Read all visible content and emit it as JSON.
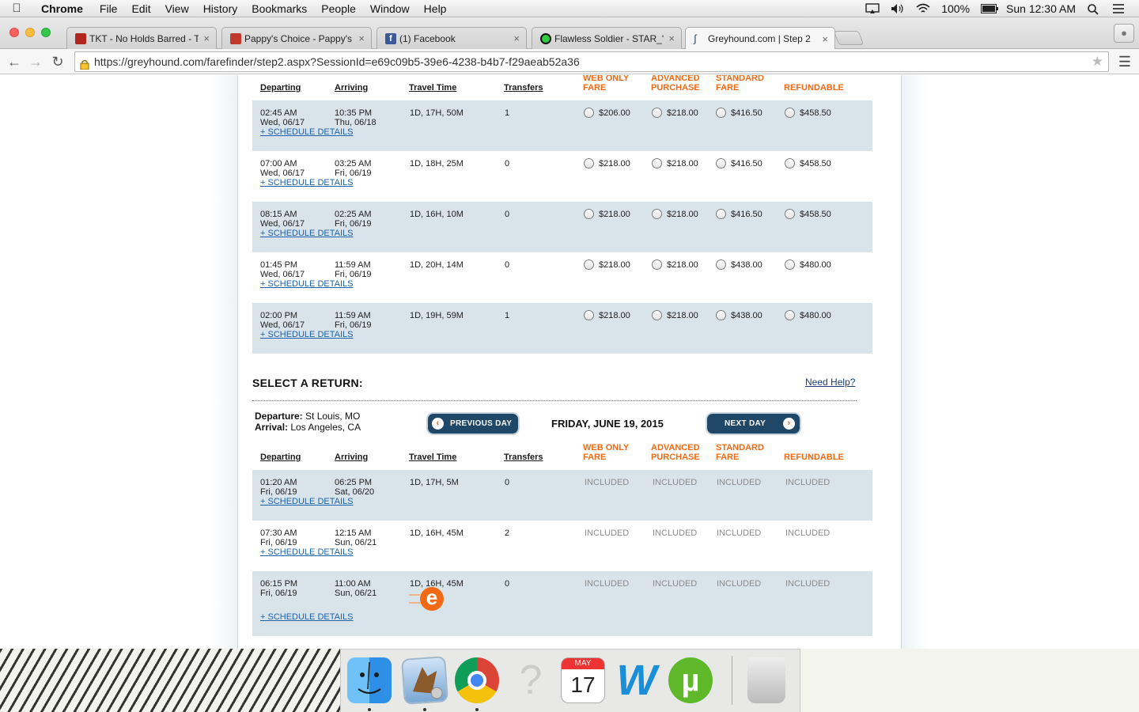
{
  "menubar": {
    "app": "Chrome",
    "items": [
      "File",
      "Edit",
      "View",
      "History",
      "Bookmarks",
      "People",
      "Window",
      "Help"
    ],
    "battery": "100%",
    "clock": "Sun 12:30 AM"
  },
  "tabs": [
    {
      "title": "TKT - No Holds Barred - T",
      "favicon_color": "#b3261e"
    },
    {
      "title": "Pappy's Choice - Pappy's",
      "favicon_color": "#c0392b"
    },
    {
      "title": "(1) Facebook",
      "favicon_color": "#3b5998"
    },
    {
      "title": "Flawless Soldier - STAR_'s",
      "favicon_color": "#2ecc40"
    },
    {
      "title": "Greyhound.com | Step 2",
      "favicon_color": "#1e4768"
    }
  ],
  "url": "https://greyhound.com/farefinder/step2.aspx?SessionId=e69c09b5-39e6-4238-b4b7-f29aeab52a36",
  "columns": {
    "departing": "Departing",
    "arriving": "Arriving",
    "travel_time": "Travel Time",
    "transfers": "Transfers",
    "web_only_1": "WEB ONLY",
    "web_only_2": "FARE",
    "advanced_1": "ADVANCED",
    "advanced_2": "PURCHASE",
    "standard_1": "STANDARD",
    "standard_2": "FARE",
    "refundable": "REFUNDABLE"
  },
  "schedule_details": "+ SCHEDULE DETAILS",
  "outbound": [
    {
      "dep_time": "02:45 AM",
      "dep_date": "Wed, 06/17",
      "arr_time": "10:35 PM",
      "arr_date": "Thu, 06/18",
      "travel": "1D, 17H, 50M",
      "transfers": "1",
      "web": "$206.00",
      "adv": "$218.00",
      "std": "$416.50",
      "ref": "$458.50"
    },
    {
      "dep_time": "07:00 AM",
      "dep_date": "Wed, 06/17",
      "arr_time": "03:25 AM",
      "arr_date": "Fri, 06/19",
      "travel": "1D, 18H, 25M",
      "transfers": "0",
      "web": "$218.00",
      "adv": "$218.00",
      "std": "$416.50",
      "ref": "$458.50"
    },
    {
      "dep_time": "08:15 AM",
      "dep_date": "Wed, 06/17",
      "arr_time": "02:25 AM",
      "arr_date": "Fri, 06/19",
      "travel": "1D, 16H, 10M",
      "transfers": "0",
      "web": "$218.00",
      "adv": "$218.00",
      "std": "$416.50",
      "ref": "$458.50"
    },
    {
      "dep_time": "01:45 PM",
      "dep_date": "Wed, 06/17",
      "arr_time": "11:59 AM",
      "arr_date": "Fri, 06/19",
      "travel": "1D, 20H, 14M",
      "transfers": "0",
      "web": "$218.00",
      "adv": "$218.00",
      "std": "$438.00",
      "ref": "$480.00"
    },
    {
      "dep_time": "02:00 PM",
      "dep_date": "Wed, 06/17",
      "arr_time": "11:59 AM",
      "arr_date": "Fri, 06/19",
      "travel": "1D, 19H, 59M",
      "transfers": "1",
      "web": "$218.00",
      "adv": "$218.00",
      "std": "$438.00",
      "ref": "$480.00"
    }
  ],
  "return_section": {
    "title": "SELECT A RETURN:",
    "need_help": "Need Help?",
    "departure_label": "Departure:",
    "departure_value": "St Louis, MO",
    "arrival_label": "Arrival:",
    "arrival_value": "Los Angeles, CA",
    "prev_day": "PREVIOUS DAY",
    "next_day": "NEXT DAY",
    "date": "FRIDAY, JUNE 19, 2015",
    "included": "INCLUDED"
  },
  "return": [
    {
      "dep_time": "01:20 AM",
      "dep_date": "Fri, 06/19",
      "arr_time": "06:25 PM",
      "arr_date": "Sat, 06/20",
      "travel": "1D, 17H, 5M",
      "transfers": "0"
    },
    {
      "dep_time": "07:30 AM",
      "dep_date": "Fri, 06/19",
      "arr_time": "12:15 AM",
      "arr_date": "Sun, 06/21",
      "travel": "1D, 16H, 45M",
      "transfers": "2"
    },
    {
      "dep_time": "06:15 PM",
      "dep_date": "Fri, 06/19",
      "arr_time": "11:00 AM",
      "arr_date": "Sun, 06/21",
      "travel": "1D, 16H, 45M",
      "transfers": "0"
    }
  ],
  "dock": {
    "calendar_month": "MAY",
    "calendar_day": "17",
    "help_glyph": "?",
    "word_glyph": "W",
    "utorrent_glyph": "µ",
    "edge_glyph": "e"
  }
}
